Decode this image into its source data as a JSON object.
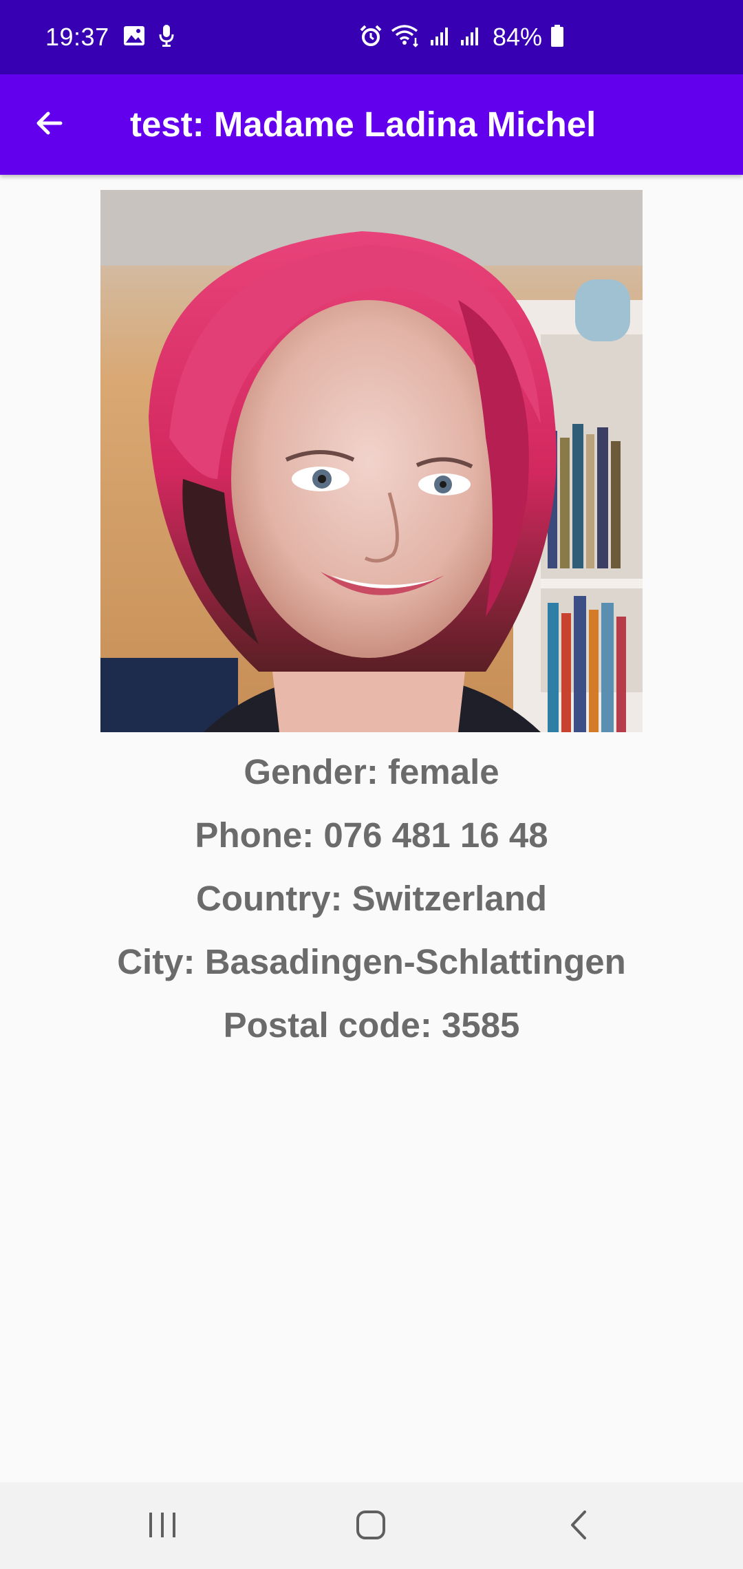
{
  "status_bar": {
    "time": "19:37",
    "battery_text": "84%",
    "icons": [
      "image-icon",
      "mic-icon",
      "alarm-icon",
      "wifi-icon",
      "signal-icon",
      "signal-icon",
      "battery-icon"
    ]
  },
  "app_bar": {
    "title": "test: Madame Ladina Michel",
    "back_icon": "arrow-back-icon"
  },
  "profile": {
    "photo": "profile-photo",
    "details": [
      "Gender: female",
      "Phone: 076 481 16 48",
      "Country: Switzerland",
      "City: Basadingen-Schlattingen",
      "Postal code: 3585"
    ]
  },
  "nav_bar": {
    "buttons": [
      "recent-apps-icon",
      "home-icon",
      "back-icon"
    ]
  },
  "colors": {
    "status_bar": "#3700b3",
    "app_bar": "#6200ee",
    "background": "#fafafa",
    "detail_text": "#6b6b6b",
    "nav_bar": "#f2f2f2"
  }
}
